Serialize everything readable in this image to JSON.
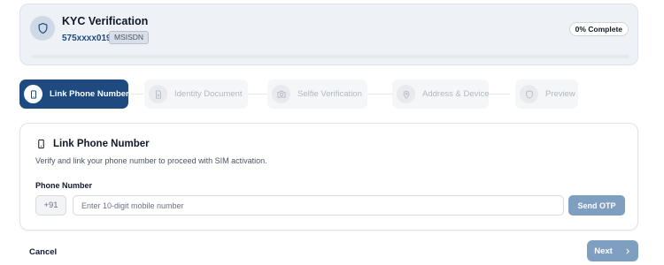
{
  "header": {
    "icon": "shield-icon",
    "title": "KYC Verification",
    "phone_masked": "575xxxx019",
    "phone_badge": "MSISDN",
    "completion_label": "0% Complete",
    "progress_fraction": 0.0,
    "accent_color": "#1e4a7f"
  },
  "stepper": {
    "steps": [
      {
        "label": "Link Phone Number",
        "icon": "phone-icon",
        "active": true
      },
      {
        "label": "Identity Document",
        "icon": "document-icon",
        "active": false
      },
      {
        "label": "Selfie Verification",
        "icon": "camera-icon",
        "active": false
      },
      {
        "label": "Address & Device",
        "icon": "location-pin-icon",
        "active": false
      },
      {
        "label": "Preview",
        "icon": "shield-icon",
        "active": false
      }
    ]
  },
  "card": {
    "icon": "phone-icon",
    "title": "Link Phone Number",
    "description": "Verify and link your phone number to proceed with SIM activation.",
    "phone_field": {
      "label": "Phone Number",
      "country_code": "+91",
      "value": "",
      "placeholder": "Enter 10-digit mobile number"
    },
    "send_otp_label": "Send OTP"
  },
  "footer": {
    "cancel_label": "Cancel",
    "next_label": "Next",
    "next_icon": "chevron-right-icon",
    "button_color": "#7f9fc1"
  }
}
